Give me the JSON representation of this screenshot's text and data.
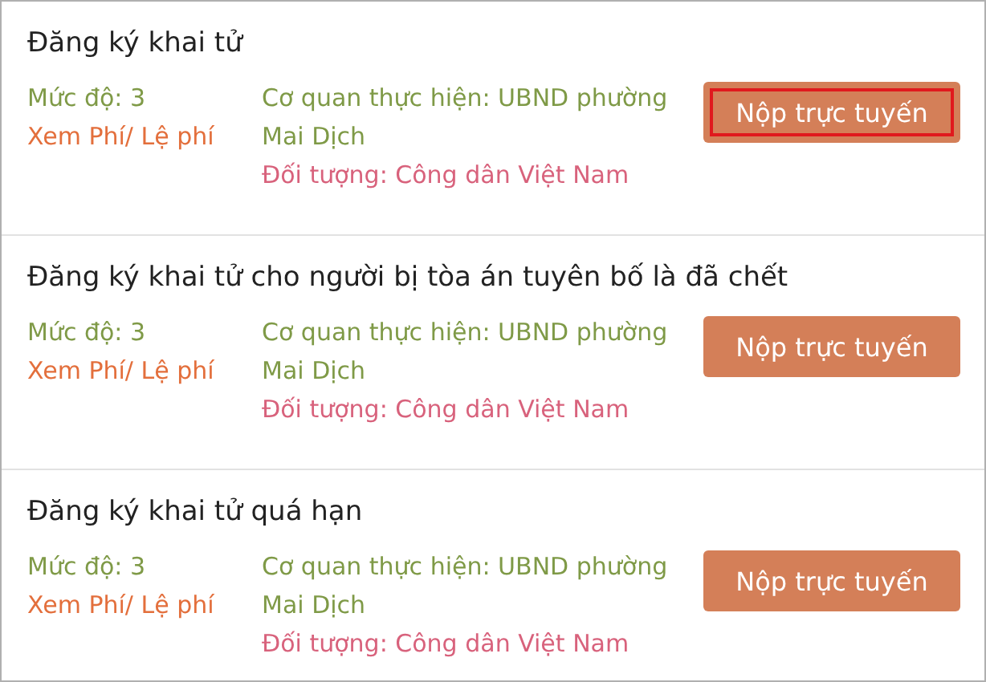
{
  "procedures": [
    {
      "title": "Đăng ký khai tử",
      "level": "Mức độ: 3",
      "fee_link": "Xem Phí/ Lệ phí",
      "agency": "Cơ quan thực hiện: UBND phường Mai Dịch",
      "audience": "Đối tượng: Công dân Việt Nam",
      "button": "Nộp trực tuyến",
      "highlighted": true
    },
    {
      "title": "Đăng ký khai tử cho người bị tòa án tuyên bố là đã chết",
      "level": "Mức độ: 3",
      "fee_link": "Xem Phí/ Lệ phí",
      "agency": "Cơ quan thực hiện: UBND phường Mai Dịch",
      "audience": "Đối tượng: Công dân Việt Nam",
      "button": "Nộp trực tuyến",
      "highlighted": false
    },
    {
      "title": "Đăng ký khai tử quá hạn",
      "level": "Mức độ: 3",
      "fee_link": "Xem Phí/ Lệ phí",
      "agency": "Cơ quan thực hiện: UBND phường Mai Dịch",
      "audience": "Đối tượng: Công dân Việt Nam",
      "button": "Nộp trực tuyến",
      "highlighted": false
    }
  ]
}
